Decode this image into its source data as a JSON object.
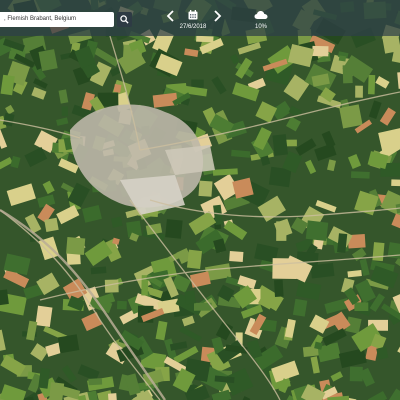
{
  "search": {
    "value": ", Flemish Brabant, Belgium"
  },
  "date_nav": {
    "date": "27/6/2018"
  },
  "cloud": {
    "value": "10%"
  },
  "icons": {
    "search": "search-icon",
    "prev": "chevron-left-icon",
    "next": "chevron-right-icon",
    "calendar": "calendar-icon",
    "cloud": "cloud-icon"
  },
  "colors": {
    "toolbar": "#2e3e48",
    "field_dark": "#2f5a27",
    "field_light": "#6f9a3c",
    "town": "#c9c1b2"
  }
}
